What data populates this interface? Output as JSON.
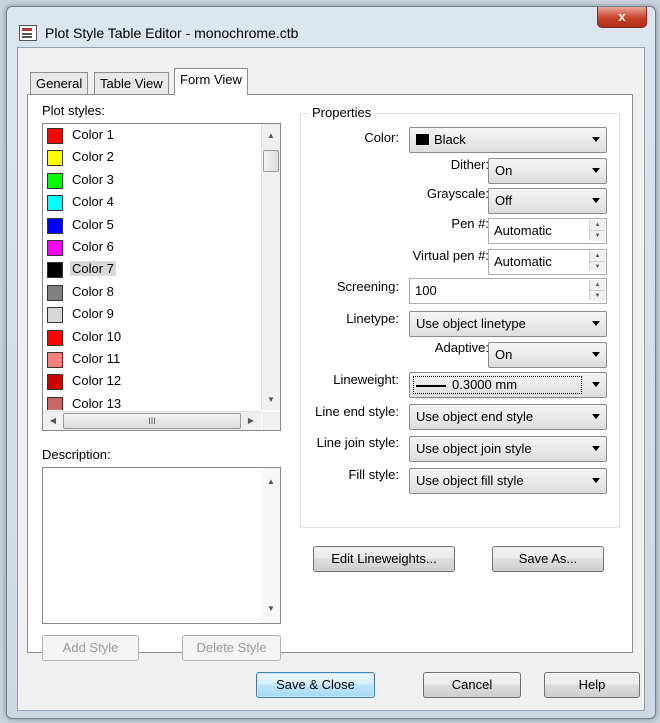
{
  "window": {
    "title": "Plot Style Table Editor - monochrome.ctb",
    "close_label": "x"
  },
  "tabs": [
    {
      "label": "General"
    },
    {
      "label": "Table View"
    },
    {
      "label": "Form View"
    }
  ],
  "plot_styles": {
    "label": "Plot styles:",
    "items": [
      {
        "label": "Color 1",
        "color": "#ff0000"
      },
      {
        "label": "Color 2",
        "color": "#ffff00"
      },
      {
        "label": "Color 3",
        "color": "#00ff00"
      },
      {
        "label": "Color 4",
        "color": "#00ffff"
      },
      {
        "label": "Color 5",
        "color": "#0000ff"
      },
      {
        "label": "Color 6",
        "color": "#ff00ff"
      },
      {
        "label": "Color 7",
        "color": "#000000"
      },
      {
        "label": "Color 8",
        "color": "#808080"
      },
      {
        "label": "Color 9",
        "color": "#d8d8d8"
      },
      {
        "label": "Color 10",
        "color": "#ff0000"
      },
      {
        "label": "Color 11",
        "color": "#ff7f7f"
      },
      {
        "label": "Color 12",
        "color": "#cc0000"
      },
      {
        "label": "Color 13",
        "color": "#cc6666"
      }
    ],
    "selected": "Color 7",
    "hscroll_grip": "III"
  },
  "description": {
    "label": "Description:",
    "value": ""
  },
  "buttons": {
    "add_style": "Add Style",
    "delete_style": "Delete Style",
    "edit_lineweights": "Edit Lineweights...",
    "save_as": "Save As...",
    "save_close": "Save & Close",
    "cancel": "Cancel",
    "help": "Help"
  },
  "properties": {
    "group_label": "Properties",
    "color": {
      "label": "Color:",
      "value": "Black"
    },
    "dither": {
      "label": "Dither:",
      "value": "On"
    },
    "grayscale": {
      "label": "Grayscale:",
      "value": "Off"
    },
    "pen": {
      "label": "Pen #:",
      "value": "Automatic"
    },
    "virtual_pen": {
      "label": "Virtual pen #:",
      "value": "Automatic"
    },
    "screening": {
      "label": "Screening:",
      "value": "100"
    },
    "linetype": {
      "label": "Linetype:",
      "value": "Use object linetype"
    },
    "adaptive": {
      "label": "Adaptive:",
      "value": "On"
    },
    "lineweight": {
      "label": "Lineweight:",
      "value": "0.3000 mm"
    },
    "line_end_style": {
      "label": "Line end style:",
      "value": "Use object end style"
    },
    "line_join_style": {
      "label": "Line join style:",
      "value": "Use object join style"
    },
    "fill_style": {
      "label": "Fill style:",
      "value": "Use object fill style"
    }
  }
}
